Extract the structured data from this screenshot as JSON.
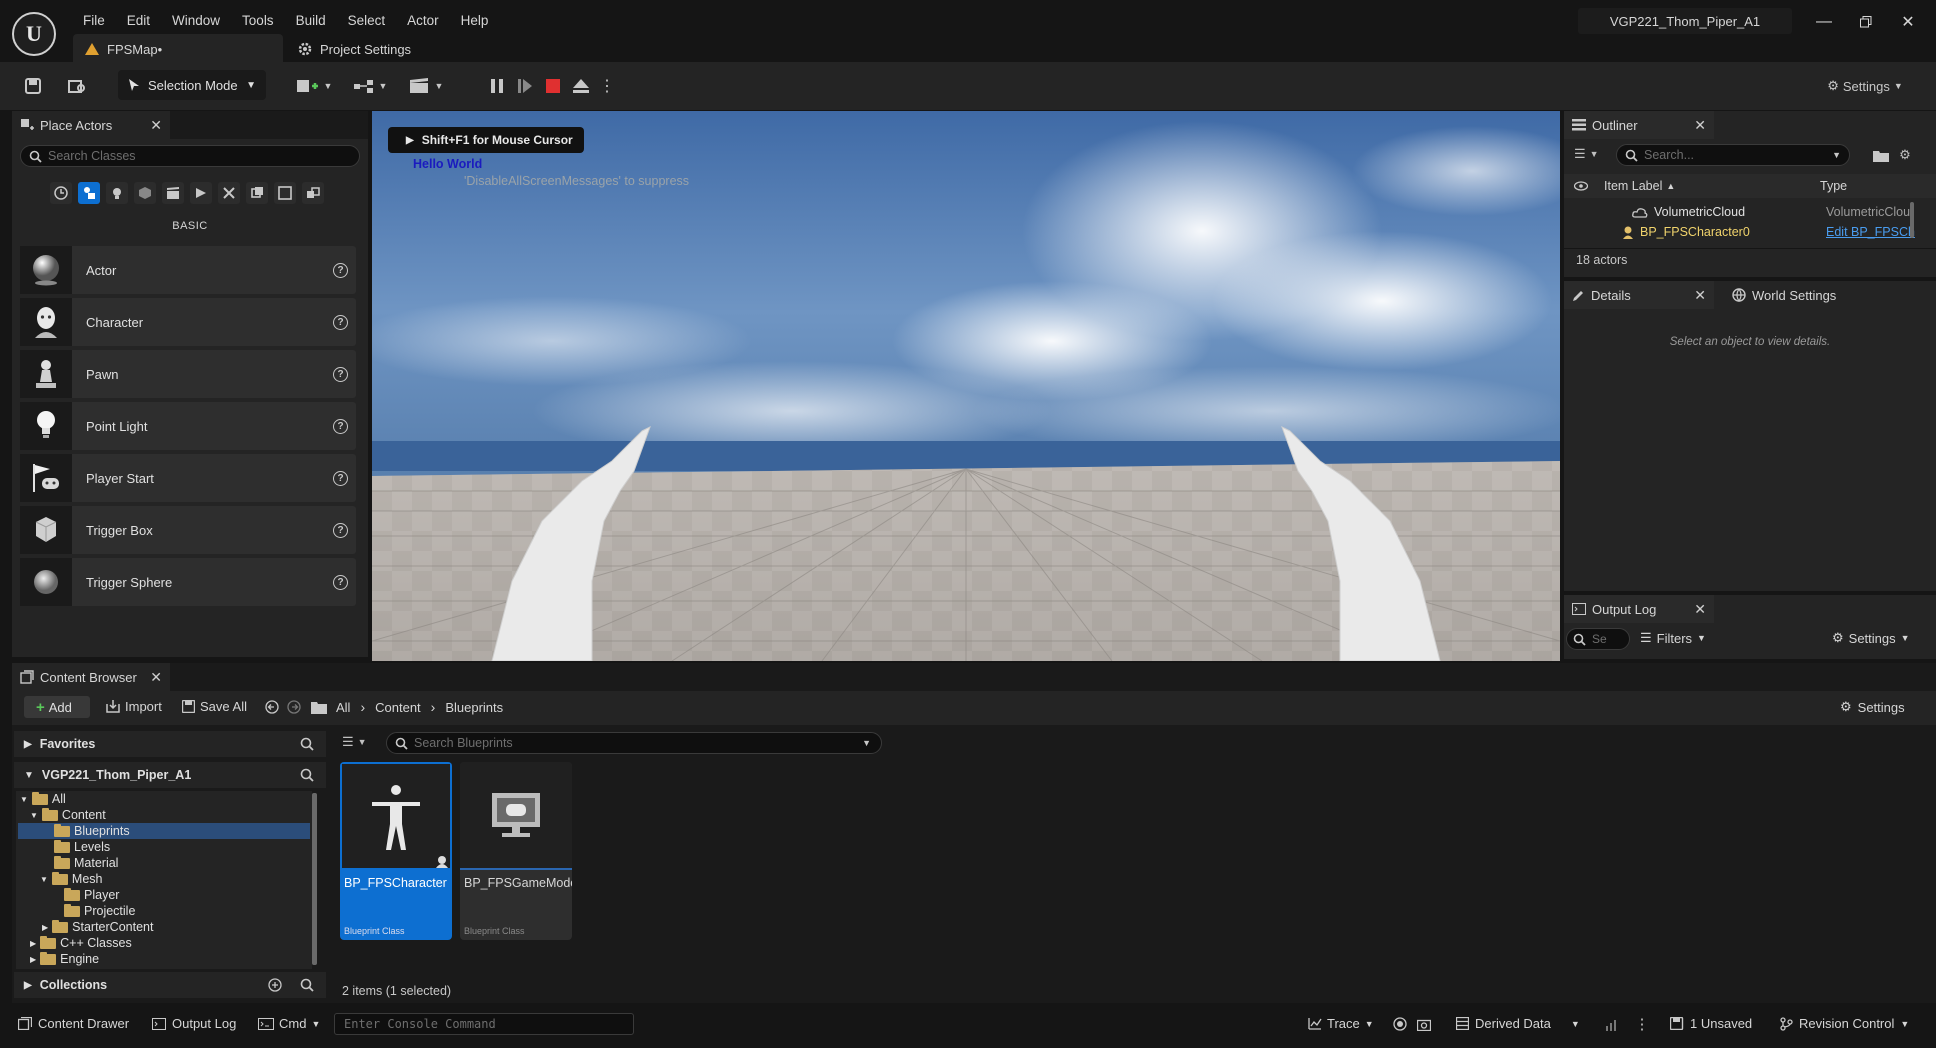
{
  "titlebar": {
    "menu": [
      "File",
      "Edit",
      "Window",
      "Tools",
      "Build",
      "Select",
      "Actor",
      "Help"
    ],
    "tabs": {
      "map": "FPSMap•",
      "project_settings": "Project Settings"
    },
    "project_name": "VGP221_Thom_Piper_A1"
  },
  "toolbar": {
    "selection_mode": "Selection Mode",
    "settings": "Settings"
  },
  "place_actors": {
    "title": "Place Actors",
    "search_placeholder": "Search Classes",
    "category": "BASIC",
    "items": [
      {
        "label": "Actor",
        "icon": "sphere-icon"
      },
      {
        "label": "Character",
        "icon": "character-icon"
      },
      {
        "label": "Pawn",
        "icon": "pawn-icon"
      },
      {
        "label": "Point Light",
        "icon": "lightbulb-icon"
      },
      {
        "label": "Player Start",
        "icon": "player-start-icon"
      },
      {
        "label": "Trigger Box",
        "icon": "trigger-box-icon"
      },
      {
        "label": "Trigger Sphere",
        "icon": "trigger-sphere-icon"
      }
    ]
  },
  "viewport": {
    "hint": "Shift+F1 for Mouse Cursor",
    "message": "Hello World",
    "suppress": "'DisableAllScreenMessages' to suppress"
  },
  "outliner": {
    "title": "Outliner",
    "search_placeholder": "Search...",
    "columns": {
      "label": "Item Label",
      "type": "Type"
    },
    "rows": [
      {
        "label": "VolumetricCloud",
        "type": "VolumetricClou"
      },
      {
        "label": "BP_FPSCharacter0",
        "type": "Edit BP_FPSCh"
      }
    ],
    "count": "18 actors"
  },
  "details": {
    "title": "Details",
    "world_settings": "World Settings",
    "empty": "Select an object to view details."
  },
  "output_log": {
    "title": "Output Log",
    "search_placeholder": "Se",
    "filters": "Filters",
    "settings": "Settings"
  },
  "content_browser": {
    "title": "Content Browser",
    "add": "Add",
    "import": "Import",
    "save_all": "Save All",
    "breadcrumb": [
      "All",
      "Content",
      "Blueprints"
    ],
    "settings": "Settings",
    "favorites": "Favorites",
    "project": "VGP221_Thom_Piper_A1",
    "tree": [
      "All",
      "Content",
      "Blueprints",
      "Levels",
      "Material",
      "Mesh",
      "Player",
      "Projectile",
      "StarterContent",
      "C++ Classes",
      "Engine"
    ],
    "collections": "Collections",
    "search_placeholder": "Search Blueprints",
    "assets": [
      {
        "name": "BP_FPSCharacter",
        "kind": "Blueprint Class",
        "selected": true
      },
      {
        "name": "BP_FPSGameMode",
        "kind": "Blueprint Class",
        "selected": false
      }
    ],
    "count": "2 items (1 selected)"
  },
  "statusbar": {
    "content_drawer": "Content Drawer",
    "output_log": "Output Log",
    "cmd": "Cmd",
    "console_placeholder": "Enter Console Command",
    "trace": "Trace",
    "derived_data": "Derived Data",
    "unsaved": "1 Unsaved",
    "revision_control": "Revision Control"
  },
  "colors": {
    "accent": "#0d6fd1",
    "panel": "#242424",
    "background": "#151515"
  }
}
